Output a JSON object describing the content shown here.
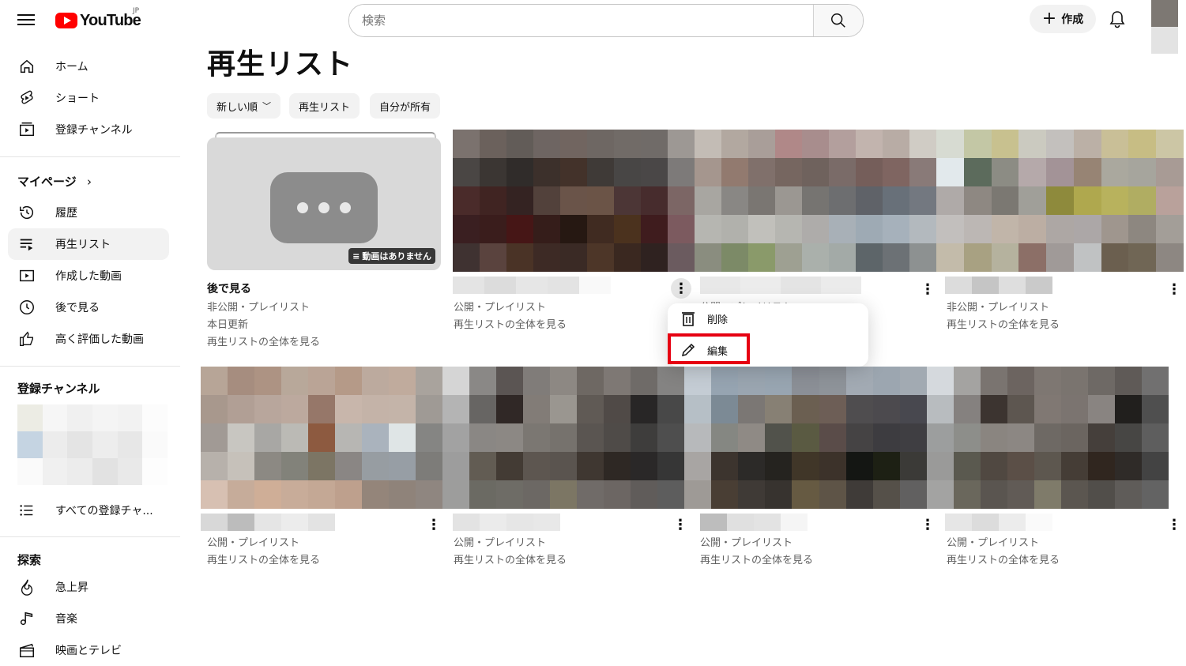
{
  "header": {
    "logo_text": "YouTube",
    "region": "JP",
    "search_placeholder": "検索",
    "create_label": "作成"
  },
  "sidebar": {
    "main": [
      {
        "label": "ホーム",
        "icon": "home-icon"
      },
      {
        "label": "ショート",
        "icon": "shorts-icon"
      },
      {
        "label": "登録チャンネル",
        "icon": "subscriptions-icon"
      }
    ],
    "mypage_title": "マイページ",
    "mypage": [
      {
        "label": "履歴",
        "icon": "history-icon"
      },
      {
        "label": "再生リスト",
        "icon": "playlist-icon",
        "active": true
      },
      {
        "label": "作成した動画",
        "icon": "your-videos-icon"
      },
      {
        "label": "後で見る",
        "icon": "watch-later-icon"
      },
      {
        "label": "高く評価した動画",
        "icon": "liked-icon"
      }
    ],
    "subscriptions_title": "登録チャンネル",
    "all_subscriptions": "すべての登録チャ...",
    "explore_title": "探索",
    "explore": [
      {
        "label": "急上昇",
        "icon": "trending-icon"
      },
      {
        "label": "音楽",
        "icon": "music-icon"
      },
      {
        "label": "映画とテレビ",
        "icon": "movies-icon"
      }
    ]
  },
  "main": {
    "title": "再生リスト",
    "chips": [
      "新しい順",
      "再生リスト",
      "自分が所有"
    ],
    "watch_later": {
      "title": "後で見る",
      "badge": "動画はありません",
      "privacy": "非公開・プレイリスト",
      "updated": "本日更新",
      "view_full": "再生リストの全体を見る"
    },
    "row1": [
      {
        "privacy": "公開・プレイリスト",
        "view_full": "再生リストの全体を見る"
      },
      {
        "privacy": "公開・プレイリスト",
        "view_full": ""
      },
      {
        "privacy": "非公開・プレイリスト",
        "view_full": "再生リストの全体を見る"
      }
    ],
    "row2": [
      {
        "privacy": "公開・プレイリスト",
        "view_full": "再生リストの全体を見る"
      },
      {
        "privacy": "公開・プレイリスト",
        "view_full": "再生リストの全体を見る"
      },
      {
        "privacy": "公開・プレイリスト",
        "view_full": "再生リストの全体を見る"
      },
      {
        "privacy": "公開・プレイリスト",
        "view_full": "再生リストの全体を見る"
      }
    ]
  },
  "context_menu": {
    "delete_label": "削除",
    "edit_label": "編集"
  },
  "colors": {
    "brand_red": "#ff0000",
    "highlight_red": "#e60012"
  }
}
